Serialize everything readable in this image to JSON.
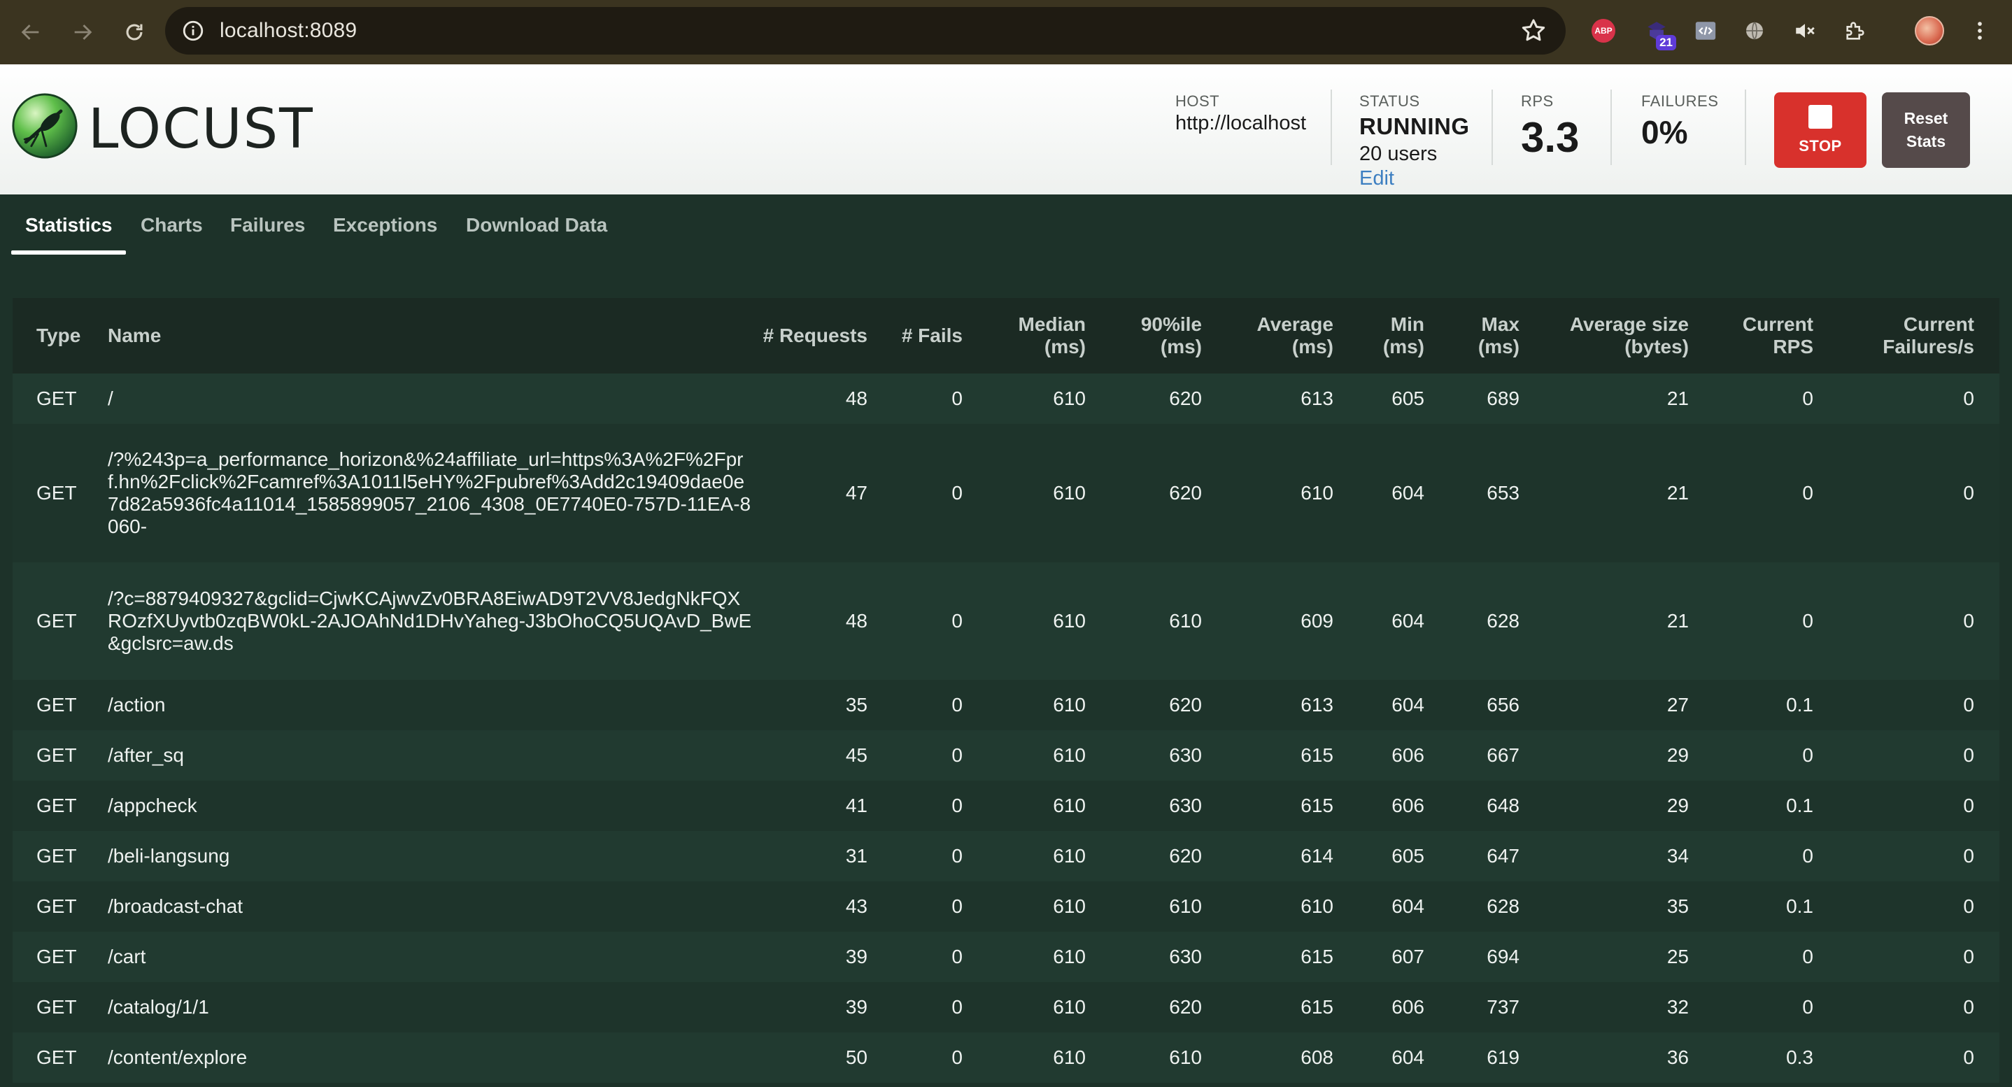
{
  "browser": {
    "url": "localhost:8089",
    "extension_badge": "21",
    "abp_label": "ABP"
  },
  "app": {
    "logo_text": "LOCUST"
  },
  "header": {
    "host_label": "HOST",
    "host_value": "http://localhost",
    "status_label": "STATUS",
    "status_value": "RUNNING",
    "users_value": "20 users",
    "edit_label": "Edit",
    "rps_label": "RPS",
    "rps_value": "3.3",
    "failures_label": "FAILURES",
    "failures_value": "0%",
    "stop_label": "STOP",
    "reset_label_line1": "Reset",
    "reset_label_line2": "Stats"
  },
  "tabs": [
    {
      "label": "Statistics",
      "active": true
    },
    {
      "label": "Charts",
      "active": false
    },
    {
      "label": "Failures",
      "active": false
    },
    {
      "label": "Exceptions",
      "active": false
    },
    {
      "label": "Download Data",
      "active": false
    }
  ],
  "table": {
    "headers": {
      "type": "Type",
      "name": "Name",
      "requests": "# Requests",
      "fails": "# Fails",
      "median_1": "Median",
      "median_2": "(ms)",
      "p90_1": "90%ile",
      "p90_2": "(ms)",
      "avg_1": "Average",
      "avg_2": "(ms)",
      "min_1": "Min",
      "min_2": "(ms)",
      "max_1": "Max",
      "max_2": "(ms)",
      "size_1": "Average size",
      "size_2": "(bytes)",
      "rps_1": "Current",
      "rps_2": "RPS",
      "cfail_1": "Current",
      "cfail_2": "Failures/s"
    },
    "rows": [
      {
        "type": "GET",
        "name": "/",
        "requests": "48",
        "fails": "0",
        "median": "610",
        "p90": "620",
        "avg": "613",
        "min": "605",
        "max": "689",
        "size": "21",
        "rps": "0",
        "cfail": "0"
      },
      {
        "type": "GET",
        "name": "/?%243p=a_performance_horizon&%24affiliate_url=https%3A%2F%2Fprf.hn%2Fclick%2Fcamref%3A1011l5eHY%2Fpubref%3Add2c19409dae0e7d82a5936fc4a11014_1585899057_2106_4308_0E7740E0-757D-11EA-8060-",
        "requests": "47",
        "fails": "0",
        "median": "610",
        "p90": "620",
        "avg": "610",
        "min": "604",
        "max": "653",
        "size": "21",
        "rps": "0",
        "cfail": "0"
      },
      {
        "type": "GET",
        "name": "/?c=8879409327&gclid=CjwKCAjwvZv0BRA8EiwAD9T2VV8JedgNkFQXROzfXUyvtb0zqBW0kL-2AJOAhNd1DHvYaheg-J3bOhoCQ5UQAvD_BwE&gclsrc=aw.ds",
        "requests": "48",
        "fails": "0",
        "median": "610",
        "p90": "610",
        "avg": "609",
        "min": "604",
        "max": "628",
        "size": "21",
        "rps": "0",
        "cfail": "0"
      },
      {
        "type": "GET",
        "name": "/action",
        "requests": "35",
        "fails": "0",
        "median": "610",
        "p90": "620",
        "avg": "613",
        "min": "604",
        "max": "656",
        "size": "27",
        "rps": "0.1",
        "cfail": "0"
      },
      {
        "type": "GET",
        "name": "/after_sq",
        "requests": "45",
        "fails": "0",
        "median": "610",
        "p90": "630",
        "avg": "615",
        "min": "606",
        "max": "667",
        "size": "29",
        "rps": "0",
        "cfail": "0"
      },
      {
        "type": "GET",
        "name": "/appcheck",
        "requests": "41",
        "fails": "0",
        "median": "610",
        "p90": "630",
        "avg": "615",
        "min": "606",
        "max": "648",
        "size": "29",
        "rps": "0.1",
        "cfail": "0"
      },
      {
        "type": "GET",
        "name": "/beli-langsung",
        "requests": "31",
        "fails": "0",
        "median": "610",
        "p90": "620",
        "avg": "614",
        "min": "605",
        "max": "647",
        "size": "34",
        "rps": "0",
        "cfail": "0"
      },
      {
        "type": "GET",
        "name": "/broadcast-chat",
        "requests": "43",
        "fails": "0",
        "median": "610",
        "p90": "610",
        "avg": "610",
        "min": "604",
        "max": "628",
        "size": "35",
        "rps": "0.1",
        "cfail": "0"
      },
      {
        "type": "GET",
        "name": "/cart",
        "requests": "39",
        "fails": "0",
        "median": "610",
        "p90": "630",
        "avg": "615",
        "min": "607",
        "max": "694",
        "size": "25",
        "rps": "0",
        "cfail": "0"
      },
      {
        "type": "GET",
        "name": "/catalog/1/1",
        "requests": "39",
        "fails": "0",
        "median": "610",
        "p90": "620",
        "avg": "615",
        "min": "606",
        "max": "737",
        "size": "32",
        "rps": "0",
        "cfail": "0"
      },
      {
        "type": "GET",
        "name": "/content/explore",
        "requests": "50",
        "fails": "0",
        "median": "610",
        "p90": "610",
        "avg": "608",
        "min": "604",
        "max": "619",
        "size": "36",
        "rps": "0.3",
        "cfail": "0"
      }
    ]
  }
}
